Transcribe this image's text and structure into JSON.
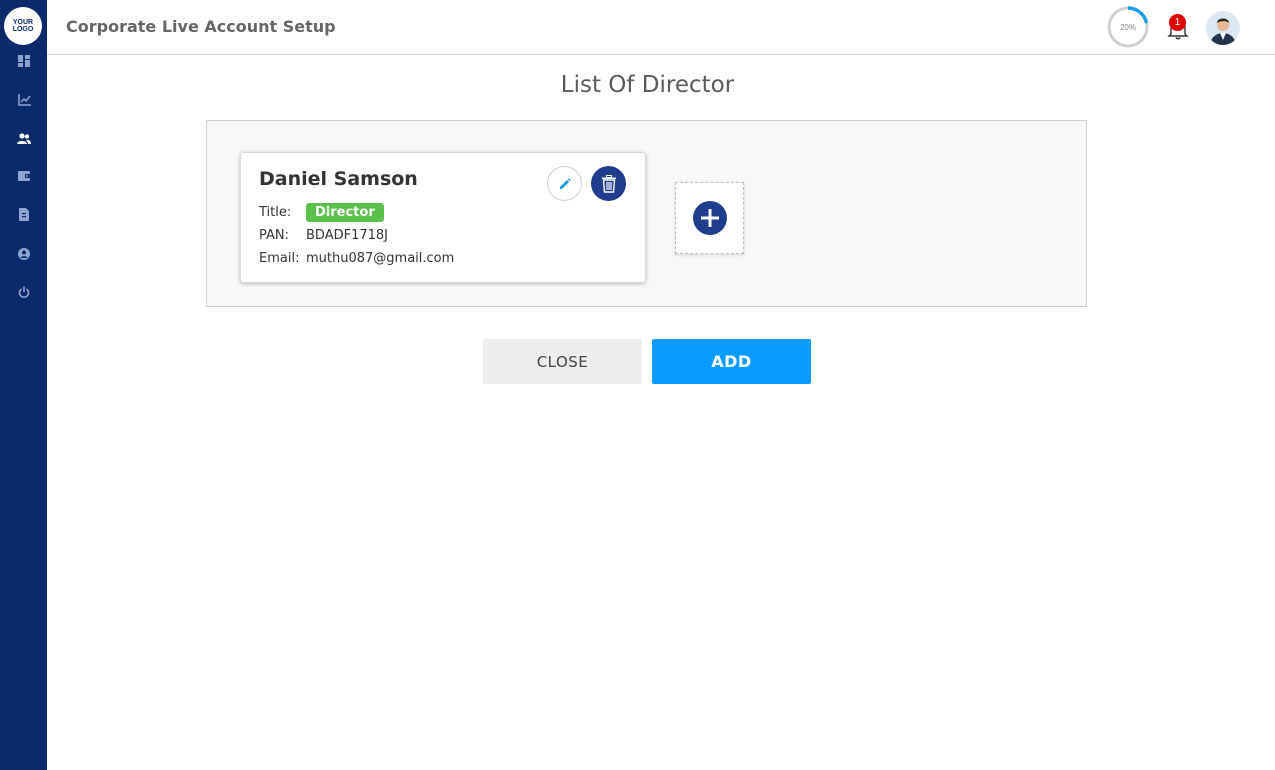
{
  "logo": {
    "line1": "YOUR",
    "line2": "LOGO"
  },
  "sidebar": {
    "items": [
      {
        "icon": "dashboard-icon"
      },
      {
        "icon": "chart-icon"
      },
      {
        "icon": "users-icon"
      },
      {
        "icon": "wallet-icon"
      },
      {
        "icon": "document-icon"
      },
      {
        "icon": "profile-icon"
      },
      {
        "icon": "power-icon"
      }
    ]
  },
  "header": {
    "title": "Corporate Live Account Setup",
    "progress_label": "20%",
    "progress_value": 0.2,
    "notification_count": "1"
  },
  "page": {
    "title": "List Of Director"
  },
  "director": {
    "name": "Daniel Samson",
    "title_label": "Title:",
    "title_value": "Director",
    "pan_label": "PAN:",
    "pan_value": "BDADF1718J",
    "email_label": "Email:",
    "email_value": "muthu087@gmail.com"
  },
  "actions": {
    "close_label": "CLOSE",
    "add_label": "ADD"
  },
  "colors": {
    "sidebar": "#0b2a6b",
    "primary": "#0a9bff",
    "badge_green": "#59c04a",
    "delete": "#1f3d8c"
  }
}
